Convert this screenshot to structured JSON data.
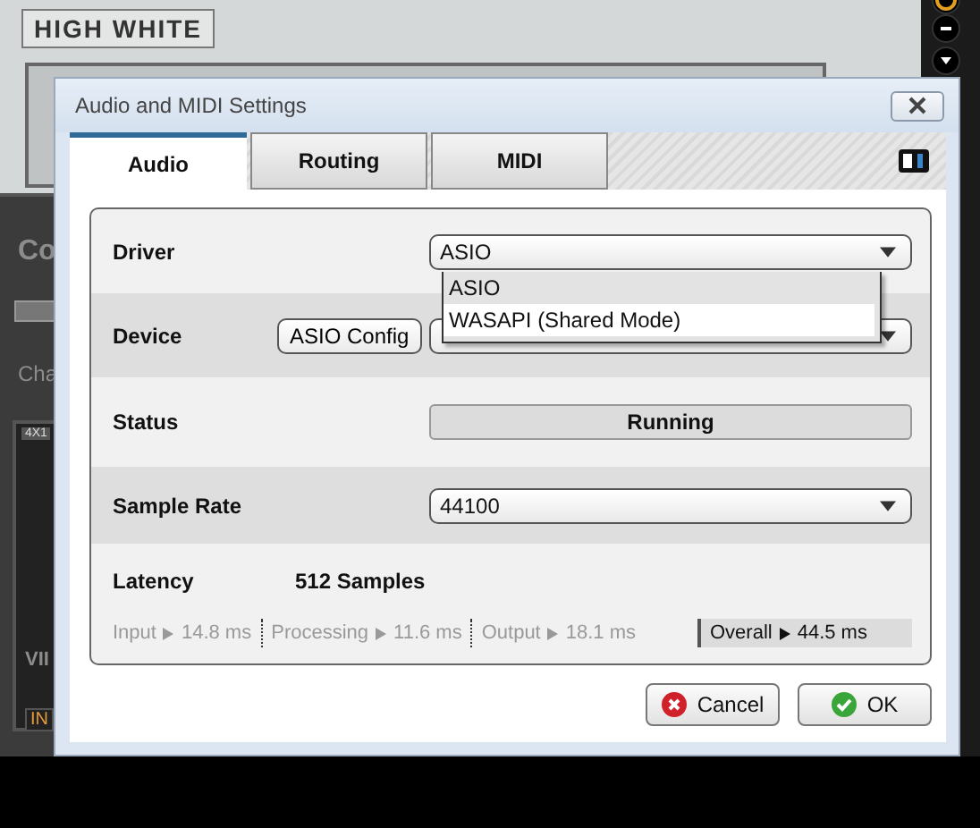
{
  "background": {
    "plate_label": "HIGH WHITE",
    "section_title": "Co",
    "channel_label": "Cha",
    "slot_badge": "4X1",
    "bottom_label": "VII",
    "input_tag": "IN"
  },
  "dialog": {
    "title": "Audio and MIDI Settings",
    "tabs": [
      {
        "label": "Audio",
        "selected": true
      },
      {
        "label": "Routing",
        "selected": false
      },
      {
        "label": "MIDI",
        "selected": false
      }
    ],
    "rows": [
      {
        "kind": "dropdown",
        "label": "Driver",
        "value": "ASIO"
      },
      {
        "kind": "dropdown",
        "label": "Device",
        "button": "ASIO Config"
      },
      {
        "kind": "status",
        "label": "Status",
        "value": "Running"
      },
      {
        "kind": "dropdown",
        "label": "Sample Rate",
        "value": "44100"
      }
    ],
    "driver_menu": [
      {
        "label": "ASIO",
        "selected": false
      },
      {
        "label": "WASAPI (Shared Mode)",
        "selected": true
      }
    ],
    "latency": {
      "label": "Latency",
      "value": "512 Samples",
      "stages": [
        {
          "kind": "stage",
          "name": "Input",
          "value": "14.8 ms"
        },
        {
          "kind": "stage",
          "name": "Processing",
          "value": "11.6 ms"
        },
        {
          "kind": "stage",
          "name": "Output",
          "value": "18.1 ms"
        },
        {
          "kind": "total",
          "name": "Overall",
          "value": "44.5 ms"
        }
      ]
    },
    "buttons": [
      {
        "kind": "cancel",
        "label": "Cancel"
      },
      {
        "kind": "ok",
        "label": "OK"
      }
    ]
  }
}
